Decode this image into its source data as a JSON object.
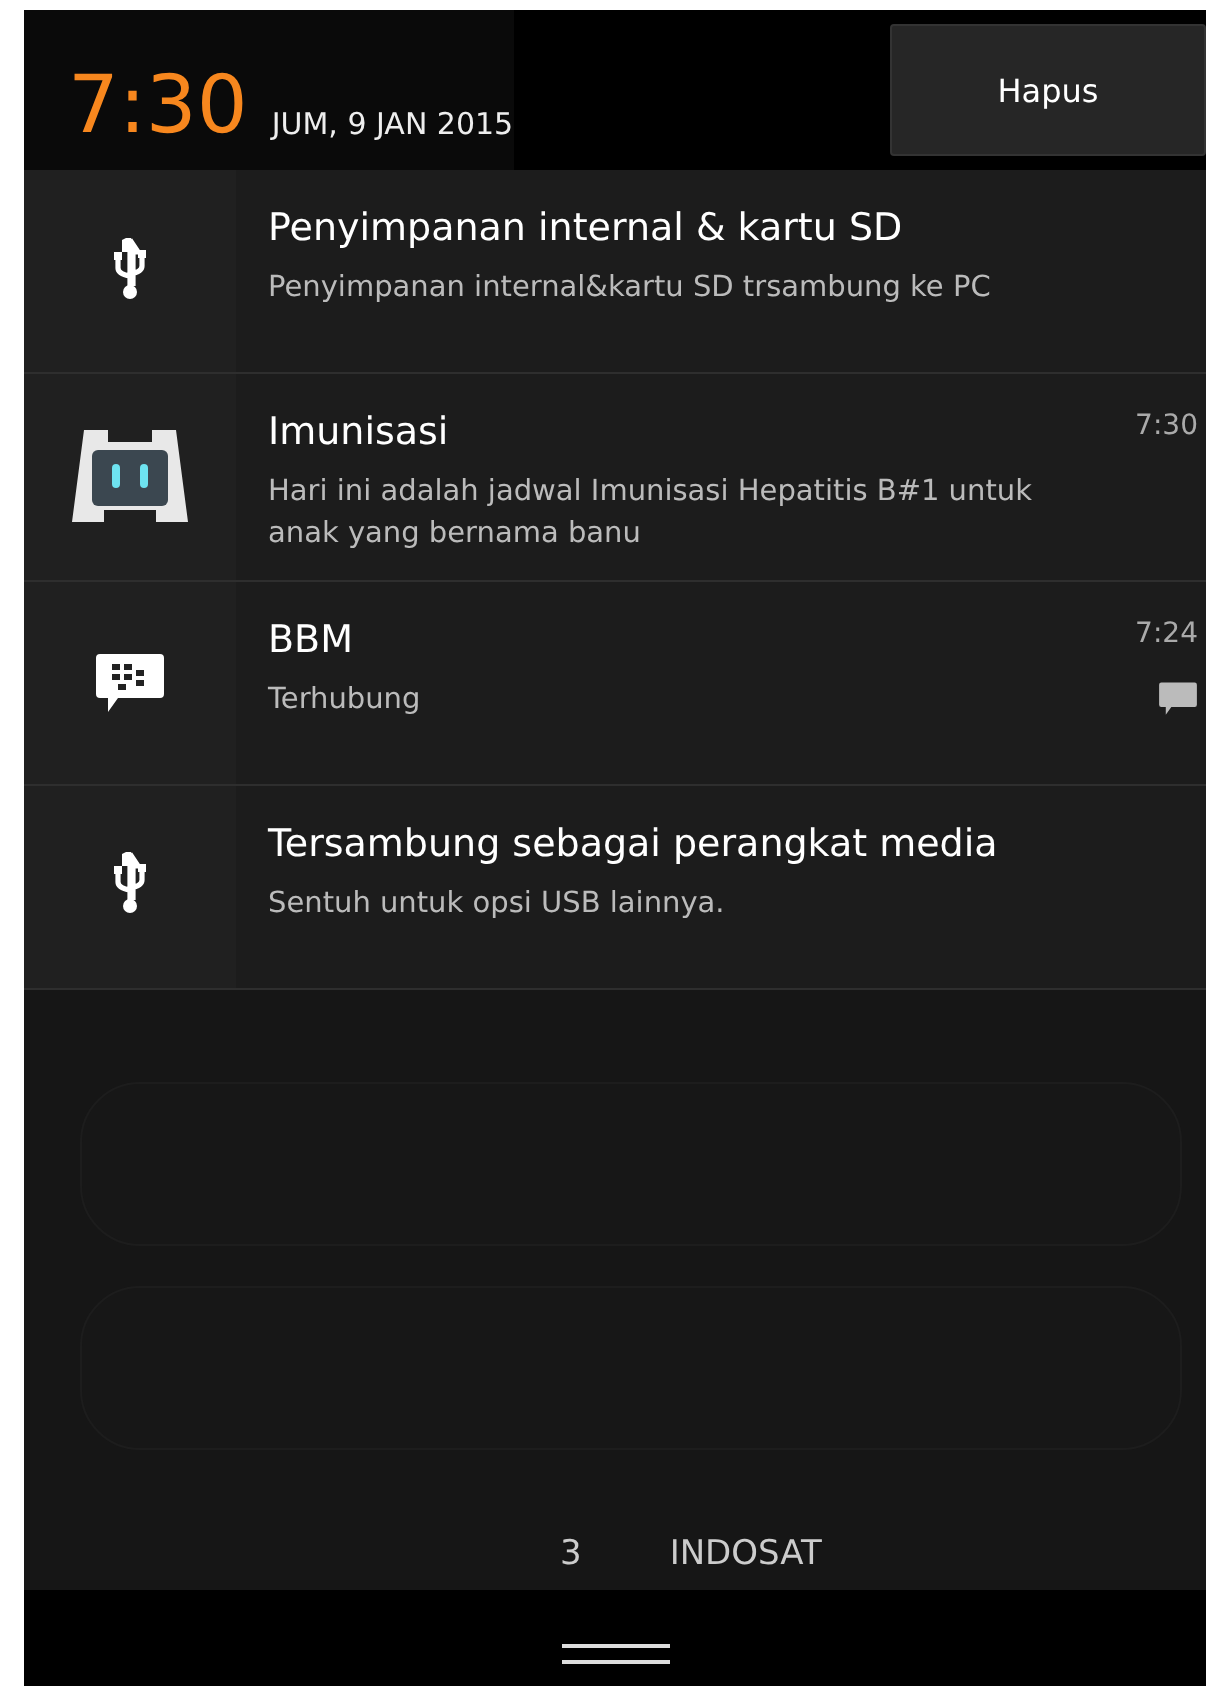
{
  "header": {
    "time": "7:30",
    "date": "JUM, 9 JAN 2015",
    "clear_button": "Hapus"
  },
  "notifications": [
    {
      "kind": "usb",
      "title": "Penyimpanan internal & kartu SD",
      "text": "Penyimpanan internal&kartu SD trsambung ke PC"
    },
    {
      "kind": "app",
      "title": "Imunisasi",
      "time": "7:30",
      "text": "Hari ini adalah jadwal Imunisasi Hepatitis B#1 untuk anak yang bernama banu"
    },
    {
      "kind": "bbm",
      "title": "BBM",
      "time": "7:24",
      "text": "Terhubung"
    },
    {
      "kind": "usb",
      "title": "Tersambung sebagai perangkat media",
      "text": "Sentuh untuk opsi USB lainnya."
    }
  ],
  "carrier": {
    "sim": "3",
    "name": "INDOSAT"
  }
}
